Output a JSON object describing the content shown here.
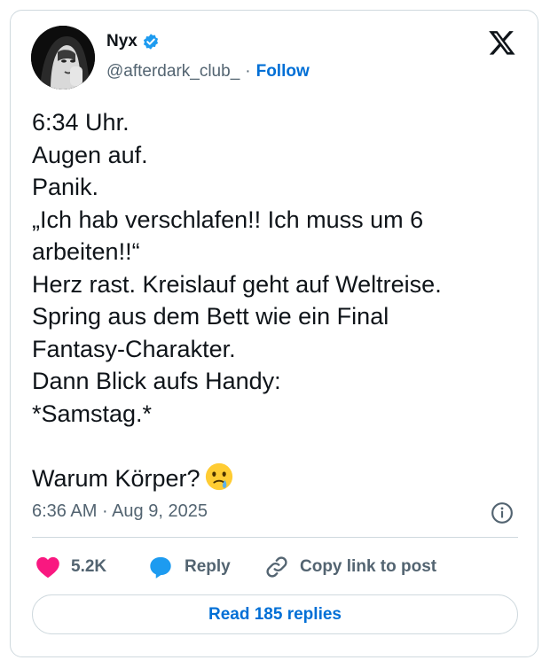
{
  "author": {
    "name": "Nyx",
    "handle": "@afterdark_club_",
    "separator": "·",
    "follow_label": "Follow",
    "verified_color": "#1d9bf0"
  },
  "tweet": {
    "lines": [
      "6:34 Uhr.",
      "Augen auf.",
      "Panik.",
      "„Ich hab verschlafen!! Ich muss um 6",
      "arbeiten!!“",
      "Herz rast. Kreislauf geht auf Weltreise.",
      "Spring aus dem Bett wie ein Final",
      "Fantasy-Charakter.",
      "Dann Blick aufs Handy:",
      "*Samstag.*"
    ],
    "last_line": "Warum Körper?",
    "emoji": "face-holding-back-tears"
  },
  "meta": {
    "time": "6:36 AM",
    "separator": "·",
    "date": "Aug 9, 2025"
  },
  "actions": {
    "likes": "5.2K",
    "reply_label": "Reply",
    "copy_label": "Copy link to post",
    "like_color": "#f91880",
    "reply_color": "#1d9bf0"
  },
  "read_replies_label": "Read 185 replies",
  "colors": {
    "accent": "#006fd6",
    "text": "#0f1419",
    "muted": "#536471",
    "border": "#cfd9de"
  }
}
